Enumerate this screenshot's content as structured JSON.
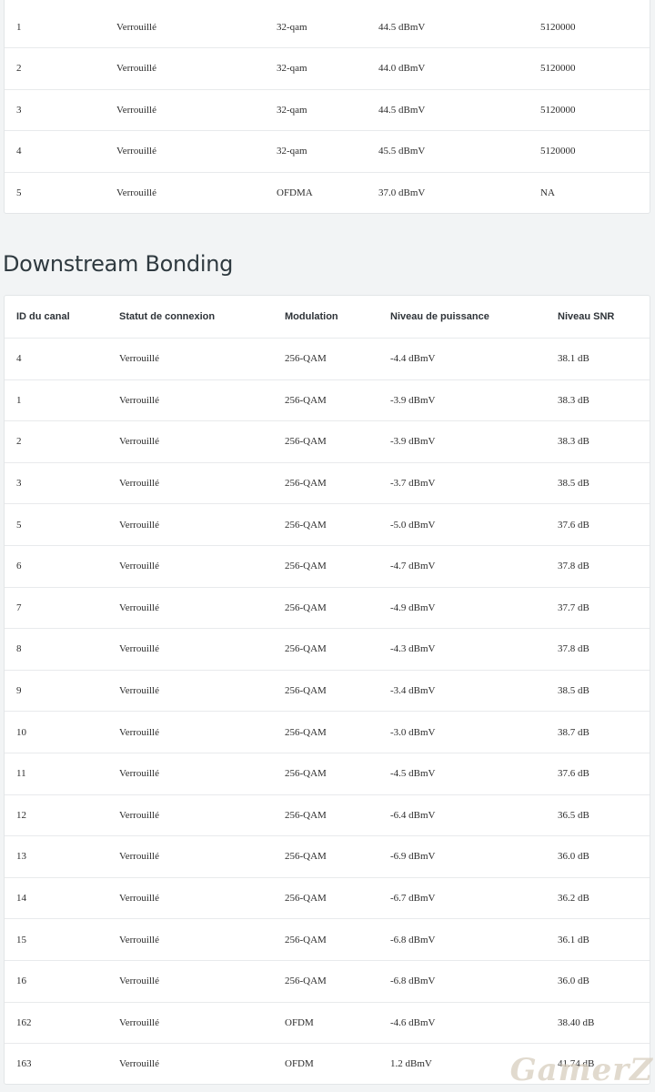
{
  "upstream": {
    "rows": [
      {
        "id": "1",
        "status": "Verrouillé",
        "modulation": "32-qam",
        "power": "44.5 dBmV",
        "symbol_rate": "5120000"
      },
      {
        "id": "2",
        "status": "Verrouillé",
        "modulation": "32-qam",
        "power": "44.0 dBmV",
        "symbol_rate": "5120000"
      },
      {
        "id": "3",
        "status": "Verrouillé",
        "modulation": "32-qam",
        "power": "44.5 dBmV",
        "symbol_rate": "5120000"
      },
      {
        "id": "4",
        "status": "Verrouillé",
        "modulation": "32-qam",
        "power": "45.5 dBmV",
        "symbol_rate": "5120000"
      },
      {
        "id": "5",
        "status": "Verrouillé",
        "modulation": "OFDMA",
        "power": "37.0 dBmV",
        "symbol_rate": "NA"
      }
    ]
  },
  "downstream": {
    "title": "Downstream Bonding",
    "headers": {
      "id": "ID du canal",
      "status": "Statut de connexion",
      "modulation": "Modulation",
      "power": "Niveau de puissance",
      "snr": "Niveau SNR"
    },
    "rows": [
      {
        "id": "4",
        "status": "Verrouillé",
        "modulation": "256-QAM",
        "power": "-4.4 dBmV",
        "snr": "38.1 dB"
      },
      {
        "id": "1",
        "status": "Verrouillé",
        "modulation": "256-QAM",
        "power": "-3.9 dBmV",
        "snr": "38.3 dB"
      },
      {
        "id": "2",
        "status": "Verrouillé",
        "modulation": "256-QAM",
        "power": "-3.9 dBmV",
        "snr": "38.3 dB"
      },
      {
        "id": "3",
        "status": "Verrouillé",
        "modulation": "256-QAM",
        "power": "-3.7 dBmV",
        "snr": "38.5 dB"
      },
      {
        "id": "5",
        "status": "Verrouillé",
        "modulation": "256-QAM",
        "power": "-5.0 dBmV",
        "snr": "37.6 dB"
      },
      {
        "id": "6",
        "status": "Verrouillé",
        "modulation": "256-QAM",
        "power": "-4.7 dBmV",
        "snr": "37.8 dB"
      },
      {
        "id": "7",
        "status": "Verrouillé",
        "modulation": "256-QAM",
        "power": "-4.9 dBmV",
        "snr": "37.7 dB"
      },
      {
        "id": "8",
        "status": "Verrouillé",
        "modulation": "256-QAM",
        "power": "-4.3 dBmV",
        "snr": "37.8 dB"
      },
      {
        "id": "9",
        "status": "Verrouillé",
        "modulation": "256-QAM",
        "power": "-3.4 dBmV",
        "snr": "38.5 dB"
      },
      {
        "id": "10",
        "status": "Verrouillé",
        "modulation": "256-QAM",
        "power": "-3.0 dBmV",
        "snr": "38.7 dB"
      },
      {
        "id": "11",
        "status": "Verrouillé",
        "modulation": "256-QAM",
        "power": "-4.5 dBmV",
        "snr": "37.6 dB"
      },
      {
        "id": "12",
        "status": "Verrouillé",
        "modulation": "256-QAM",
        "power": "-6.4 dBmV",
        "snr": "36.5 dB"
      },
      {
        "id": "13",
        "status": "Verrouillé",
        "modulation": "256-QAM",
        "power": "-6.9 dBmV",
        "snr": "36.0 dB"
      },
      {
        "id": "14",
        "status": "Verrouillé",
        "modulation": "256-QAM",
        "power": "-6.7 dBmV",
        "snr": "36.2 dB"
      },
      {
        "id": "15",
        "status": "Verrouillé",
        "modulation": "256-QAM",
        "power": "-6.8 dBmV",
        "snr": "36.1 dB"
      },
      {
        "id": "16",
        "status": "Verrouillé",
        "modulation": "256-QAM",
        "power": "-6.8 dBmV",
        "snr": "36.0 dB"
      },
      {
        "id": "162",
        "status": "Verrouillé",
        "modulation": "OFDM",
        "power": "-4.6 dBmV",
        "snr": "38.40 dB"
      },
      {
        "id": "163",
        "status": "Verrouillé",
        "modulation": "OFDM",
        "power": "1.2 dBmV",
        "snr": "41.74 dB"
      }
    ]
  },
  "watermark": "GamerZ"
}
